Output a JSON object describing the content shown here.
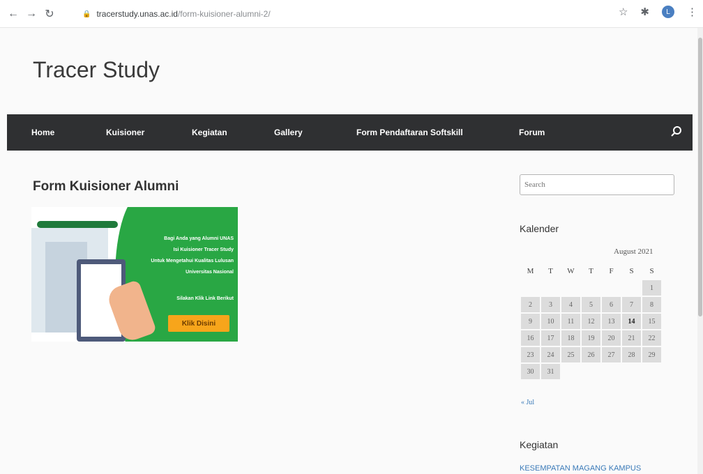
{
  "browser": {
    "url_host": "tracerstudy.unas.ac.id",
    "url_path": "/form-kuisioner-alumni-2/",
    "avatar_letter": "L"
  },
  "site": {
    "title": "Tracer Study"
  },
  "menu": {
    "items": [
      "Home",
      "Kuisioner",
      "Kegiatan",
      "Gallery",
      "Form Pendaftaran Softskill",
      "Forum"
    ]
  },
  "post": {
    "title": "Form Kuisioner Alumni",
    "banner": {
      "line1": "Bagi Anda yang Alumni UNAS",
      "line2": "Isi Kuisioner Tracer Study",
      "line3": "Untuk Mengetahui Kualitas Lulusan",
      "line4": "Universitas Nasional",
      "line5": "Silakan Klik Link Berikut",
      "button": "Klik Disini"
    }
  },
  "sidebar": {
    "search_placeholder": "Search",
    "calendar_title": "Kalender",
    "calendar_caption": "August 2021",
    "weekdays": [
      "M",
      "T",
      "W",
      "T",
      "F",
      "S",
      "S"
    ],
    "weeks": [
      [
        "",
        "",
        "",
        "",
        "",
        "",
        "1"
      ],
      [
        "2",
        "3",
        "4",
        "5",
        "6",
        "7",
        "8"
      ],
      [
        "9",
        "10",
        "11",
        "12",
        "13",
        "14",
        "15"
      ],
      [
        "16",
        "17",
        "18",
        "19",
        "20",
        "21",
        "22"
      ],
      [
        "23",
        "24",
        "25",
        "26",
        "27",
        "28",
        "29"
      ],
      [
        "30",
        "31",
        "",
        "",
        "",
        "",
        ""
      ]
    ],
    "today": "14",
    "prev_link": "« Jul",
    "kegiatan_title": "Kegiatan",
    "kegiatan_link": "KESEMPATAN MAGANG KAMPUS"
  }
}
